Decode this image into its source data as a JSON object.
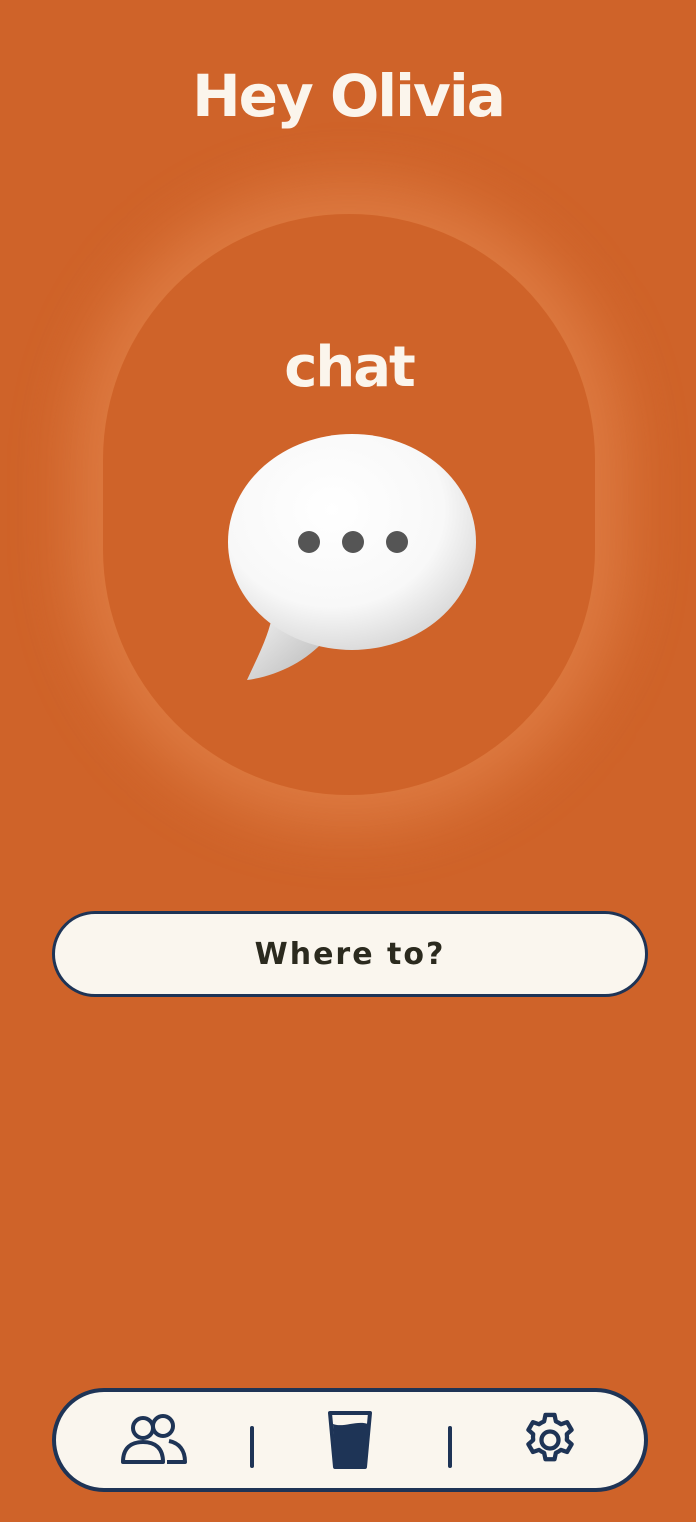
{
  "header": {
    "greeting": "Hey Olivia"
  },
  "chat_card": {
    "label": "chat",
    "icon": "speech-bubble-icon"
  },
  "search": {
    "button_label": "Where to?"
  },
  "bottom_nav": {
    "items": [
      {
        "icon": "people-icon"
      },
      {
        "icon": "drink-glass-icon"
      },
      {
        "icon": "gear-icon"
      }
    ]
  },
  "colors": {
    "background": "#CF6329",
    "text_light": "#FBF5EC",
    "button_fill": "#FAF6EE",
    "outline_navy": "#1E3456",
    "button_text": "#2B2A1E"
  }
}
